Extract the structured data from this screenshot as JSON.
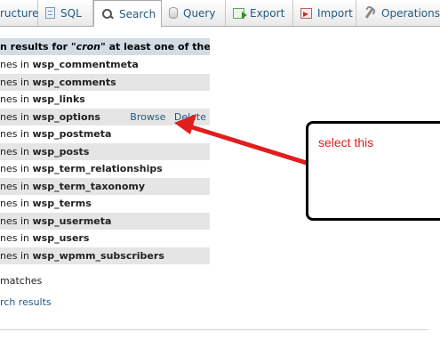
{
  "tabs": [
    {
      "label": "ructure",
      "icon": "table-structure-icon"
    },
    {
      "label": "SQL",
      "icon": "sql-icon"
    },
    {
      "label": "Search",
      "icon": "search-icon",
      "active": true
    },
    {
      "label": "Query",
      "icon": "query-icon"
    },
    {
      "label": "Export",
      "icon": "export-icon"
    },
    {
      "label": "Import",
      "icon": "import-icon"
    },
    {
      "label": "Operations",
      "icon": "operations-icon"
    }
  ],
  "results": {
    "caption_prefix": "n results for \"",
    "caption_term": "cron",
    "caption_suffix": "\" at least one of the words:",
    "rows": [
      {
        "prefix": "nes in ",
        "table": "wsp_commentmeta"
      },
      {
        "prefix": "nes in ",
        "table": "wsp_comments"
      },
      {
        "prefix": "nes in ",
        "table": "wsp_links"
      },
      {
        "prefix": "nes in ",
        "table": "wsp_options",
        "browse": "Browse",
        "delete": "Delete"
      },
      {
        "prefix": "nes in ",
        "table": "wsp_postmeta"
      },
      {
        "prefix": "nes in ",
        "table": "wsp_posts"
      },
      {
        "prefix": "nes in ",
        "table": "wsp_term_relationships"
      },
      {
        "prefix": "nes in ",
        "table": "wsp_term_taxonomy"
      },
      {
        "prefix": "nes in ",
        "table": "wsp_terms"
      },
      {
        "prefix": "nes in ",
        "table": "wsp_usermeta"
      },
      {
        "prefix": "nes in ",
        "table": "wsp_users"
      },
      {
        "prefix": "nes in ",
        "table": "wsp_wpmm_subscribers"
      }
    ],
    "total": " matches",
    "new_search": "rch results"
  },
  "annotation": {
    "text": "select this",
    "color": "#e02020"
  },
  "colors": {
    "link": "#235a81",
    "caption_bg": "#d3dce3",
    "row_alt_bg": "#e5e5e5"
  }
}
